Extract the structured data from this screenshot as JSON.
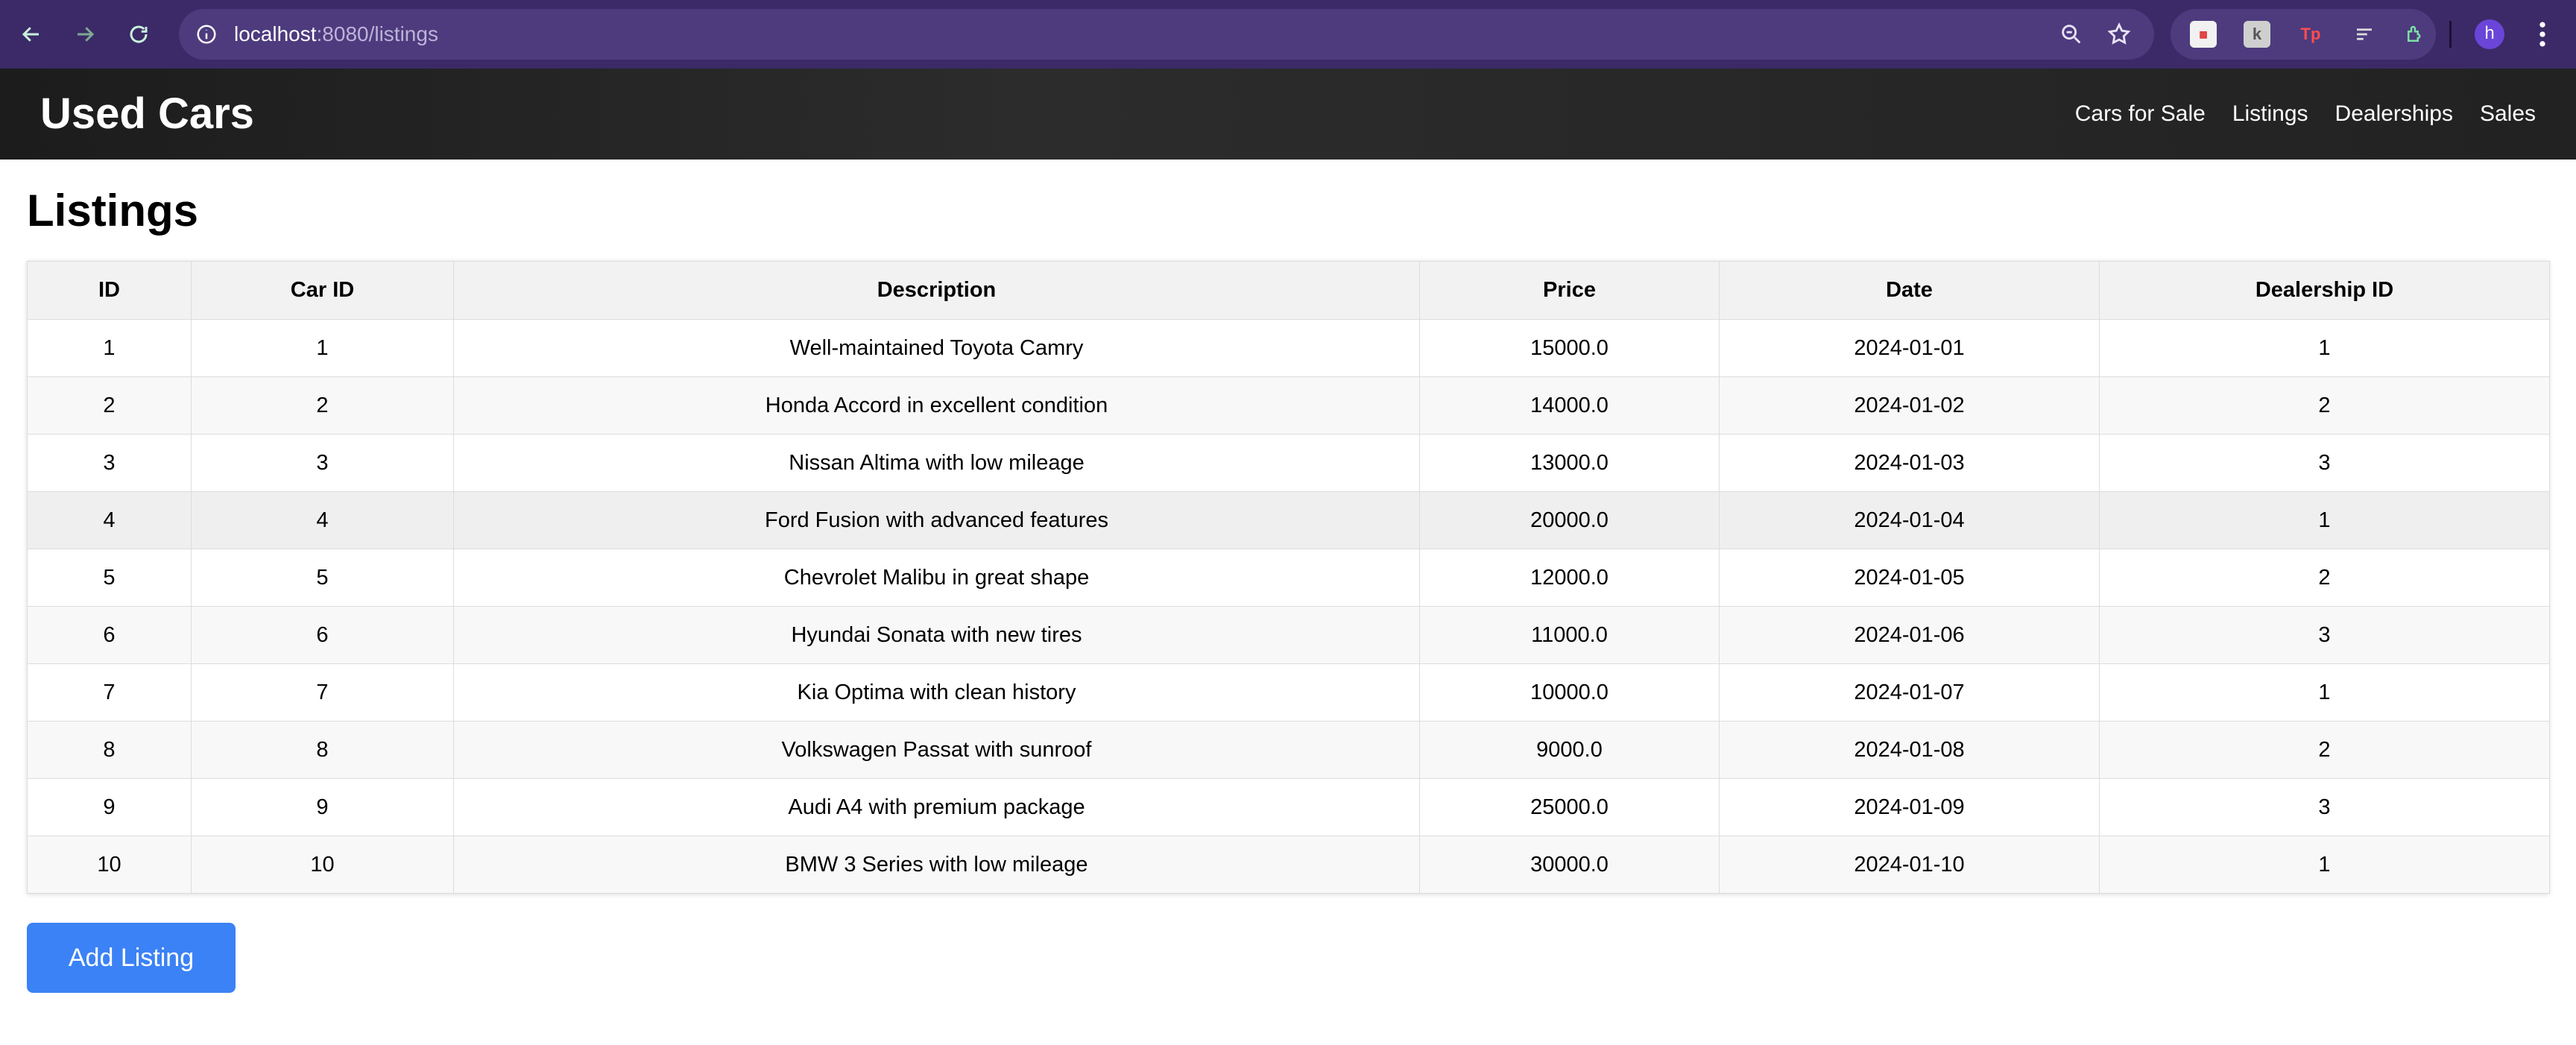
{
  "browser": {
    "url_host": "localhost",
    "url_path": ":8080/listings",
    "profile_initial": "h"
  },
  "site": {
    "title": "Used Cars",
    "nav": [
      "Cars for Sale",
      "Listings",
      "Dealerships",
      "Sales"
    ]
  },
  "page": {
    "title": "Listings",
    "add_button": "Add Listing"
  },
  "table": {
    "headers": [
      "ID",
      "Car ID",
      "Description",
      "Price",
      "Date",
      "Dealership ID"
    ],
    "rows": [
      [
        "1",
        "1",
        "Well-maintained Toyota Camry",
        "15000.0",
        "2024-01-01",
        "1"
      ],
      [
        "2",
        "2",
        "Honda Accord in excellent condition",
        "14000.0",
        "2024-01-02",
        "2"
      ],
      [
        "3",
        "3",
        "Nissan Altima with low mileage",
        "13000.0",
        "2024-01-03",
        "3"
      ],
      [
        "4",
        "4",
        "Ford Fusion with advanced features",
        "20000.0",
        "2024-01-04",
        "1"
      ],
      [
        "5",
        "5",
        "Chevrolet Malibu in great shape",
        "12000.0",
        "2024-01-05",
        "2"
      ],
      [
        "6",
        "6",
        "Hyundai Sonata with new tires",
        "11000.0",
        "2024-01-06",
        "3"
      ],
      [
        "7",
        "7",
        "Kia Optima with clean history",
        "10000.0",
        "2024-01-07",
        "1"
      ],
      [
        "8",
        "8",
        "Volkswagen Passat with sunroof",
        "9000.0",
        "2024-01-08",
        "2"
      ],
      [
        "9",
        "9",
        "Audi A4 with premium package",
        "25000.0",
        "2024-01-09",
        "3"
      ],
      [
        "10",
        "10",
        "BMW 3 Series with low mileage",
        "30000.0",
        "2024-01-10",
        "1"
      ]
    ]
  },
  "colors": {
    "browser_bar": "#3b2a67",
    "header_bg": "#222222",
    "button_blue": "#3b82f6"
  },
  "icons": [
    "back-icon",
    "forward-icon",
    "reload-icon",
    "info-icon",
    "zoom-icon",
    "star-icon",
    "extensions-icon",
    "menu-icon"
  ]
}
